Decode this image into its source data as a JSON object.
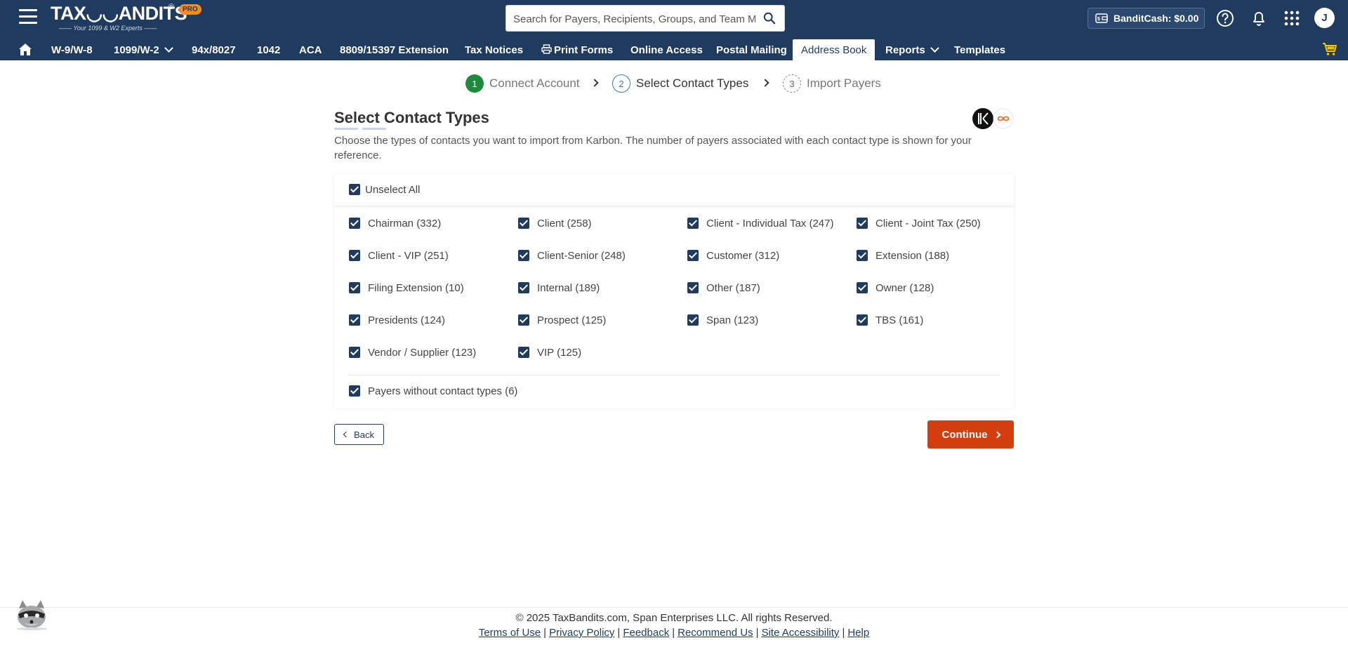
{
  "header": {
    "logo_text": "TAX◡◡ANDITS",
    "logo_registered": "®",
    "logo_badge": "PRO",
    "logo_tagline": "—— Your 1099 & W2 Experts ——",
    "search": {
      "placeholder": "Search for Payers, Recipients, Groups, and Team Members"
    },
    "bandit_cash": "BanditCash: $0.00",
    "avatar_initial": "J"
  },
  "nav": {
    "items": [
      {
        "label": "W-9/W-8"
      },
      {
        "label": "1099/W-2"
      },
      {
        "label": "94x/8027"
      },
      {
        "label": "1042"
      },
      {
        "label": "ACA"
      },
      {
        "label": "8809/15397 Extension"
      },
      {
        "label": "Tax Notices"
      },
      {
        "label": "Print Forms"
      },
      {
        "label": "Online Access"
      },
      {
        "label": "Postal Mailing"
      },
      {
        "label": "Address Book"
      },
      {
        "label": "Reports"
      },
      {
        "label": "Templates"
      }
    ],
    "active": "Address Book"
  },
  "stepper": {
    "steps": [
      {
        "number": "1",
        "label": "Connect Account",
        "state": "done"
      },
      {
        "number": "2",
        "label": "Select Contact Types",
        "state": "current"
      },
      {
        "number": "3",
        "label": "Import Payers",
        "state": "todo"
      }
    ]
  },
  "main": {
    "title": "Select Contact Types",
    "description": "Choose the types of contacts you want to import from Karbon. The number of payers associated with each contact type is shown for your reference.",
    "unselect_all_label": "Unselect All",
    "contact_types": [
      {
        "label": "Chairman (332)",
        "checked": true
      },
      {
        "label": "Client (258)",
        "checked": true
      },
      {
        "label": "Client - Individual Tax (247)",
        "checked": true
      },
      {
        "label": "Client - Joint Tax (250)",
        "checked": true
      },
      {
        "label": "Client - VIP (251)",
        "checked": true
      },
      {
        "label": "Client-Senior (248)",
        "checked": true
      },
      {
        "label": "Customer (312)",
        "checked": true
      },
      {
        "label": "Extension (188)",
        "checked": true
      },
      {
        "label": "Filing Extension (10)",
        "checked": true
      },
      {
        "label": "Internal (189)",
        "checked": true
      },
      {
        "label": "Other (187)",
        "checked": true
      },
      {
        "label": "Owner (128)",
        "checked": true
      },
      {
        "label": "Presidents (124)",
        "checked": true
      },
      {
        "label": "Prospect (125)",
        "checked": true
      },
      {
        "label": "Span (123)",
        "checked": true
      },
      {
        "label": "TBS (161)",
        "checked": true
      },
      {
        "label": "Vendor / Supplier (123)",
        "checked": true
      },
      {
        "label": "VIP (125)",
        "checked": true
      }
    ],
    "no_type_label": "Payers without contact types (6)",
    "back_label": "Back",
    "continue_label": "Continue"
  },
  "footer": {
    "copyright": "© 2025 TaxBandits.com, Span Enterprises LLC. All rights Reserved.",
    "links": [
      "Terms of Use",
      "Privacy Policy",
      "Feedback",
      "Recommend Us",
      "Site Accessibility",
      "Help"
    ]
  },
  "colors": {
    "header_bg": "#1f3b5f",
    "accent_orange": "#d43d0e",
    "step_done": "#1e8a3c",
    "step_current": "#2d7cc1"
  }
}
